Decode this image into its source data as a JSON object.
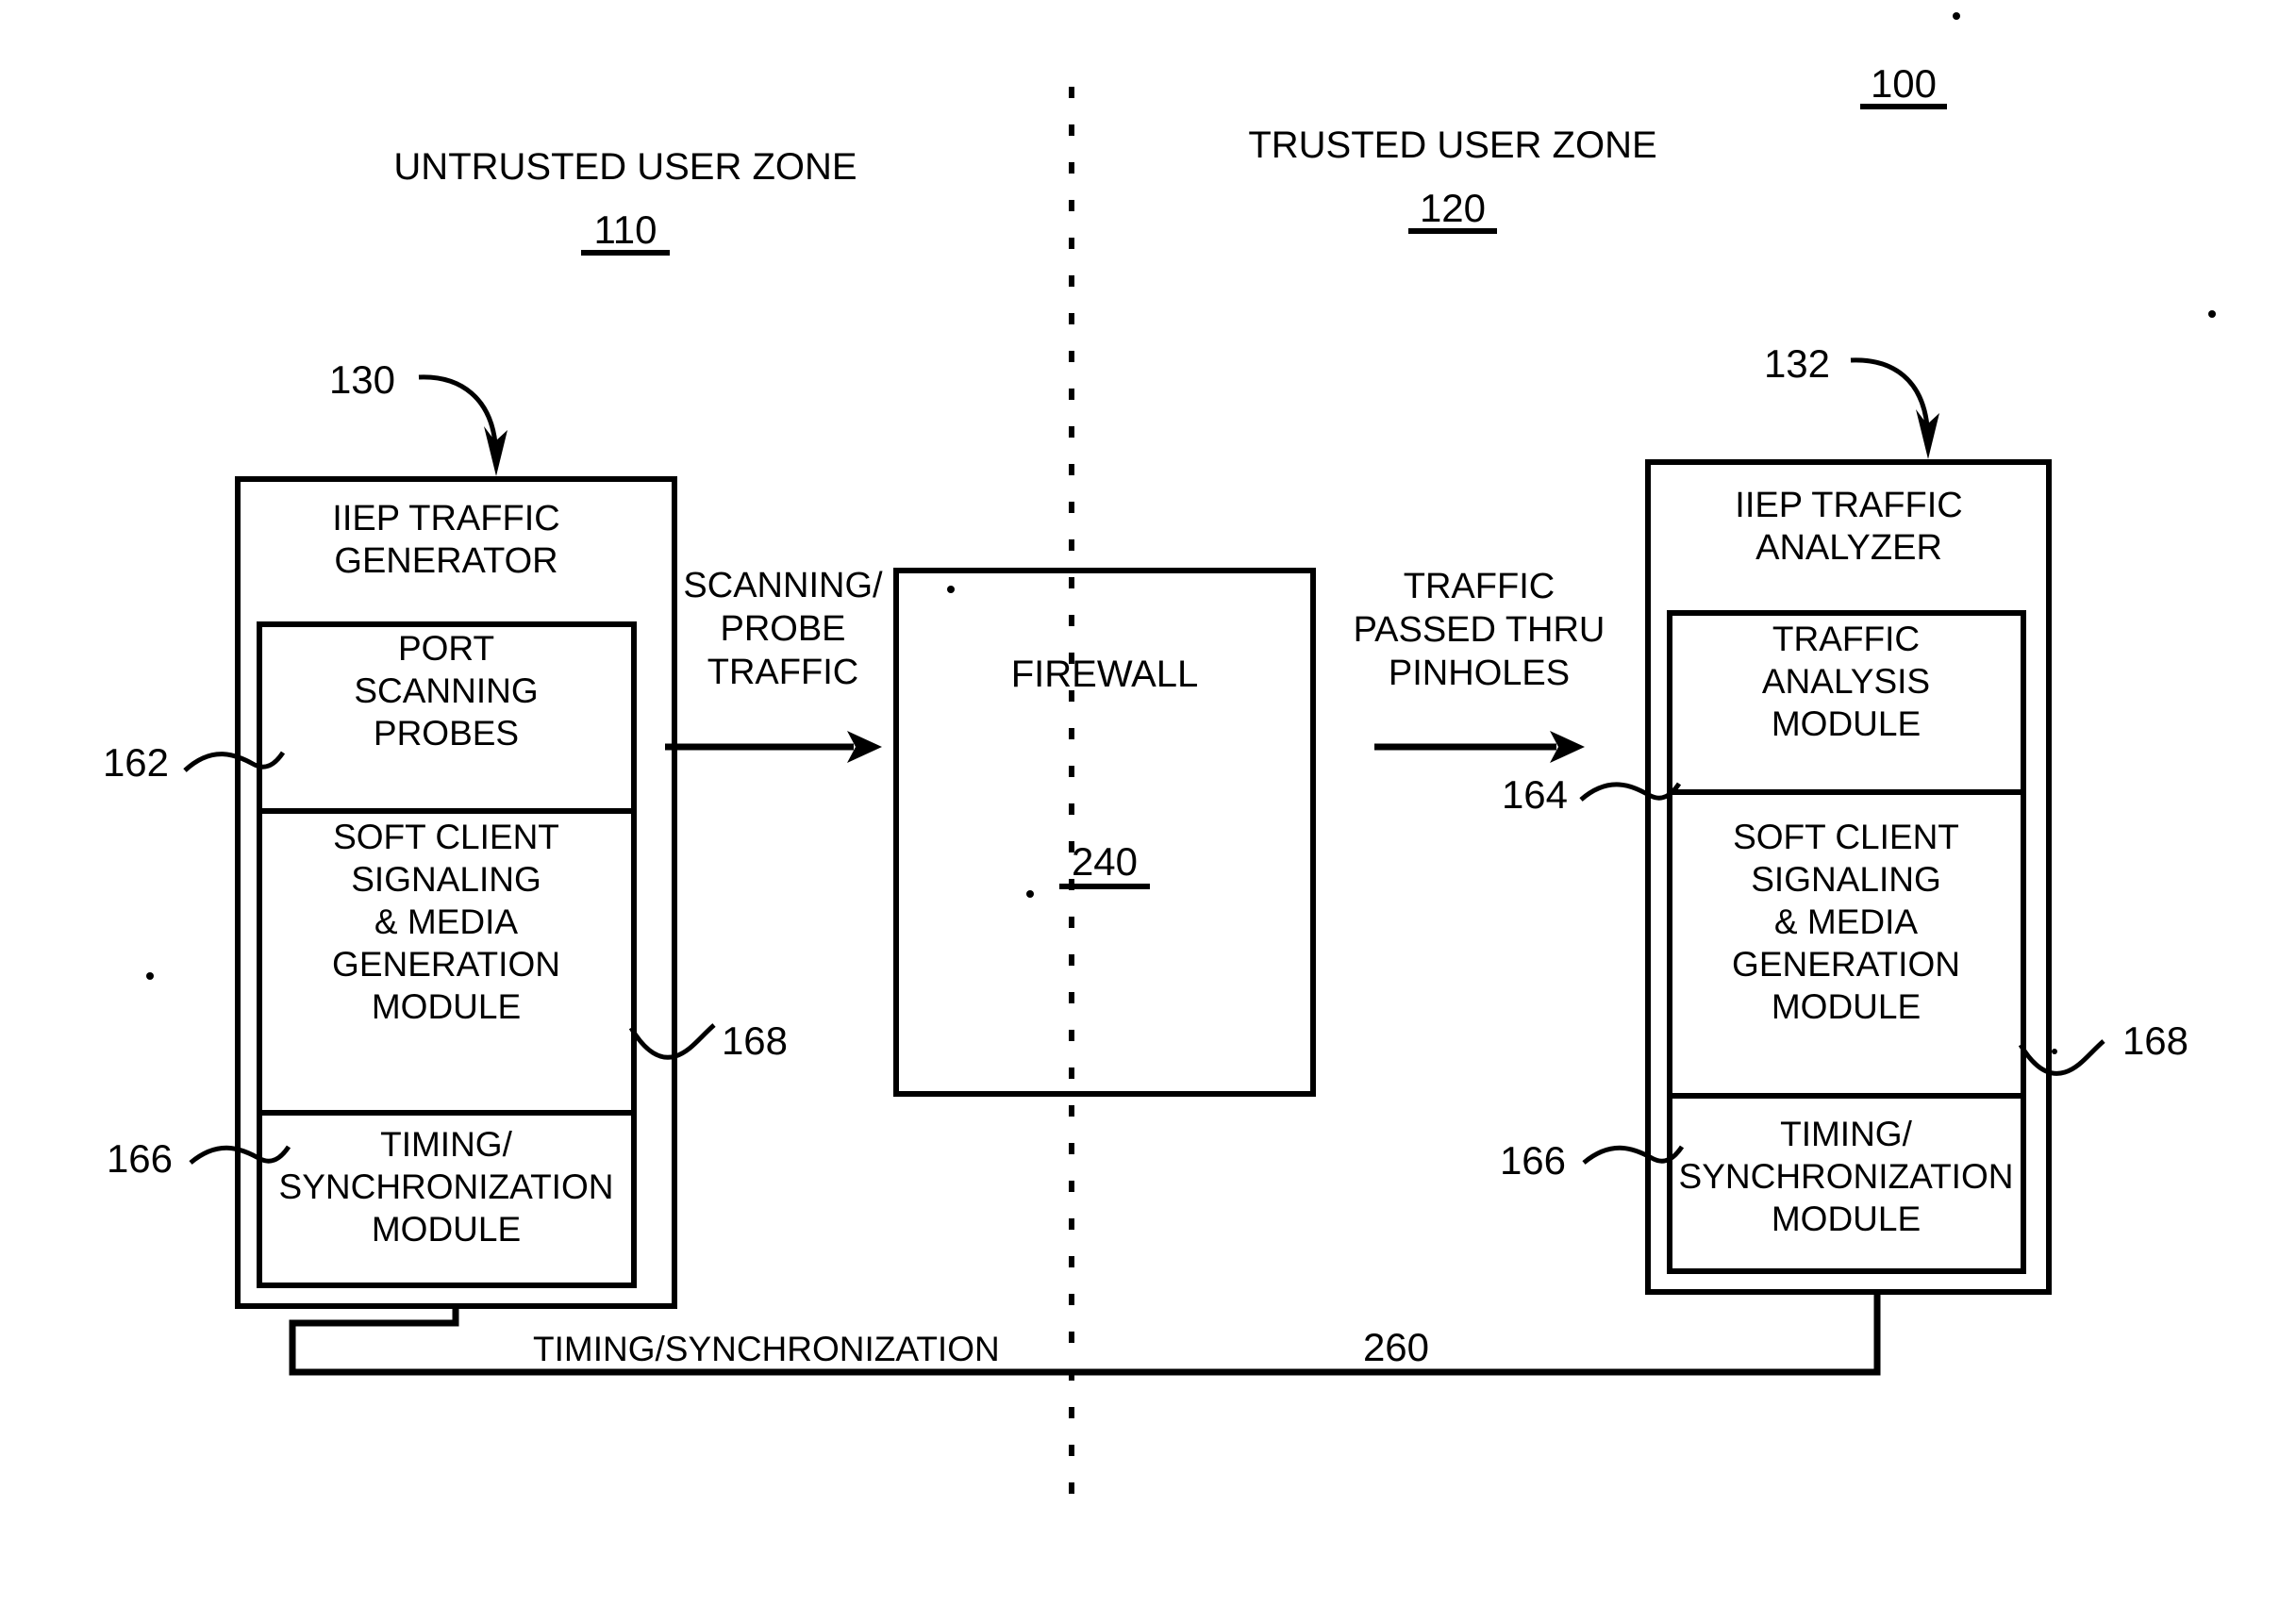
{
  "figure": {
    "figure_number": "100",
    "zones": [
      {
        "title": "UNTRUSTED USER ZONE",
        "number": "110"
      },
      {
        "title": "TRUSTED USER ZONE",
        "number": "120"
      }
    ],
    "left_module": {
      "callout": "130",
      "title_line1": "IIEP TRAFFIC",
      "title_line2": "GENERATOR",
      "sections": [
        {
          "ref": "162",
          "lines": [
            "PORT",
            "SCANNING",
            "PROBES"
          ]
        },
        {
          "ref": "168",
          "lines": [
            "SOFT CLIENT",
            "SIGNALING",
            "& MEDIA",
            "GENERATION",
            "MODULE"
          ]
        },
        {
          "ref": "166",
          "lines": [
            "TIMING/",
            "SYNCHRONIZATION",
            "MODULE"
          ]
        }
      ]
    },
    "right_module": {
      "callout": "132",
      "title_line1": "IIEP TRAFFIC",
      "title_line2": "ANALYZER",
      "sections": [
        {
          "ref": "164",
          "lines": [
            "TRAFFIC",
            "ANALYSIS",
            "MODULE"
          ]
        },
        {
          "ref": "168",
          "lines": [
            "SOFT CLIENT",
            "SIGNALING",
            "& MEDIA",
            "GENERATION",
            "MODULE"
          ]
        },
        {
          "ref": "166",
          "lines": [
            "TIMING/",
            "SYNCHRONIZATION",
            "MODULE"
          ]
        }
      ]
    },
    "firewall": {
      "label": "FIREWALL",
      "number": "240"
    },
    "flows": [
      {
        "lines": [
          "SCANNING/",
          "PROBE",
          "TRAFFIC"
        ]
      },
      {
        "lines": [
          "TRAFFIC",
          "PASSED THRU",
          "PINHOLES"
        ]
      }
    ],
    "bottom_link": {
      "label": "TIMING/SYNCHRONIZATION",
      "number": "260"
    }
  }
}
